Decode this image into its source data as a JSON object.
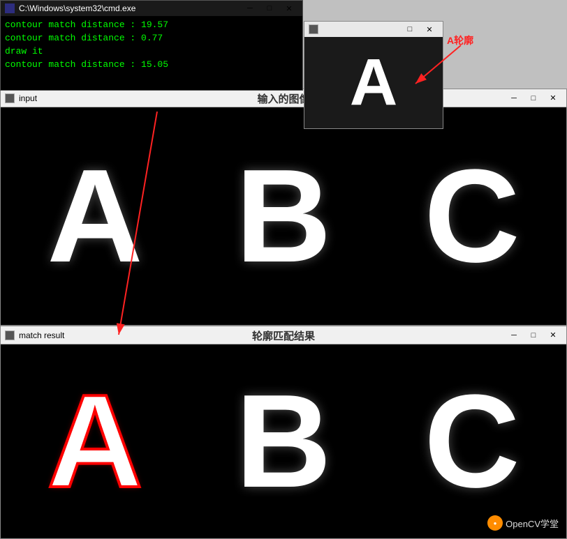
{
  "cmd_window": {
    "title": "C:\\Windows\\system32\\cmd.exe",
    "lines": [
      {
        "text": "contour match distance : 19.57",
        "color": "#00ff00"
      },
      {
        "text": "contour match distance : 0.77",
        "color": "#00ff00"
      },
      {
        "text": "draw it",
        "color": "#00ff00"
      },
      {
        "text": "contour match distance : 15.05",
        "color": "#00ff00"
      }
    ],
    "minimize": "─",
    "maximize": "□",
    "close": "✕"
  },
  "input_window": {
    "title": "input",
    "label_zh": "输入的图像",
    "minimize": "─",
    "maximize": "□",
    "close": "✕",
    "letters": [
      "A",
      "B",
      "C"
    ]
  },
  "a_contour_popup": {
    "title": "",
    "label_zh": "A轮廓",
    "letter": "A",
    "minimize": "□",
    "close": "✕"
  },
  "match_window": {
    "title": "match result",
    "label_zh": "轮廓匹配结果",
    "minimize": "─",
    "maximize": "□",
    "close": "✕",
    "letters": [
      "A",
      "B",
      "C"
    ]
  },
  "watermark": {
    "logo": "●",
    "text": "OpenCV学堂"
  },
  "arrows": {
    "arrow1_label": "A轮廓"
  }
}
